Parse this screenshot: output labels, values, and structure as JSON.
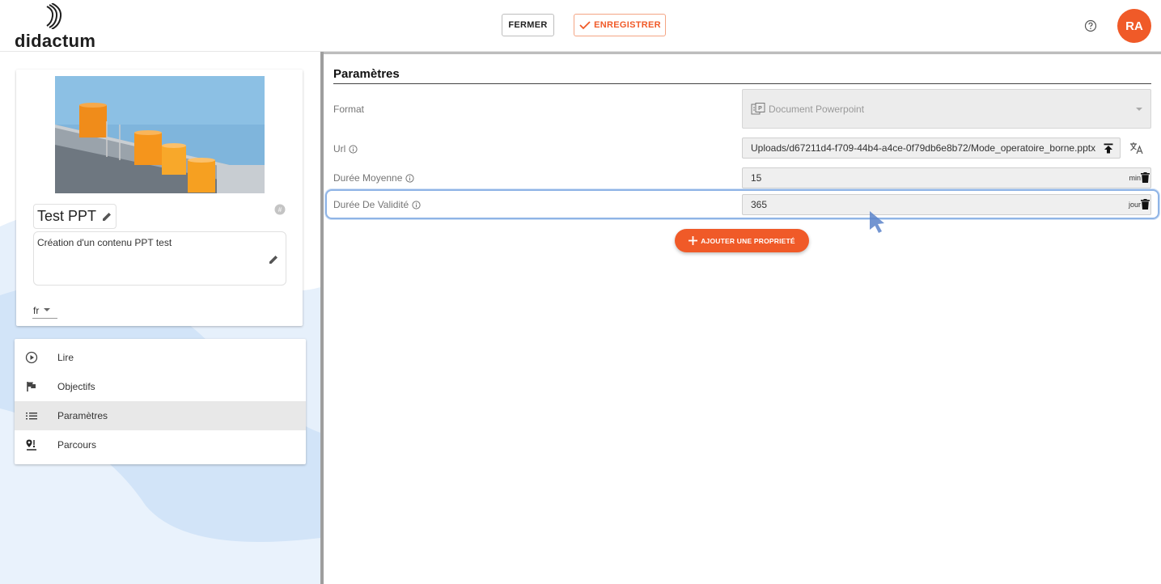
{
  "header": {
    "logo_text": "didactum",
    "close_label": "FERMER",
    "save_label": "ENREGISTRER",
    "avatar_initials": "RA",
    "brand_color": "#f05a28"
  },
  "content_card": {
    "title": "Test PPT",
    "description": "Création d'un contenu PPT test",
    "language": "fr"
  },
  "menu": {
    "items": [
      {
        "label": "Lire",
        "icon": "play-circle-icon",
        "active": false
      },
      {
        "label": "Objectifs",
        "icon": "flag-icon",
        "active": false
      },
      {
        "label": "Paramètres",
        "icon": "list-icon",
        "active": true
      },
      {
        "label": "Parcours",
        "icon": "route-icon",
        "active": false
      }
    ]
  },
  "parameters": {
    "section_title": "Paramètres",
    "format": {
      "label": "Format",
      "value": "Document Powerpoint"
    },
    "url": {
      "label": "Url",
      "value": "Uploads/d67211d4-f709-44b4-a4ce-0f79db6e8b72/Mode_operatoire_borne.pptx"
    },
    "duree_moyenne": {
      "label": "Durée Moyenne",
      "value": "15",
      "unit": "min"
    },
    "duree_validite": {
      "label": "Durée De Validité",
      "value": "365",
      "unit": "jour"
    },
    "add_property_label": "AJOUTER UNE PROPRIETÉ"
  }
}
